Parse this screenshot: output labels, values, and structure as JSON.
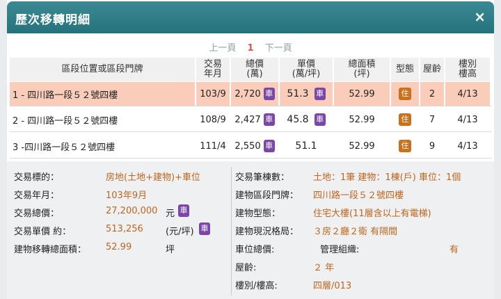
{
  "dialog": {
    "title": "歷次移轉明細",
    "close_label": "×"
  },
  "pager": {
    "prev": "上一頁",
    "current": "1",
    "next": "下一頁"
  },
  "table": {
    "headers": [
      {
        "l1": "區段位置或區段門牌",
        "l2": ""
      },
      {
        "l1": "交易",
        "l2": "年月"
      },
      {
        "l1": "總價",
        "l2": "(萬)"
      },
      {
        "l1": "單價",
        "l2": "(萬/坪)"
      },
      {
        "l1": "總面積",
        "l2": "(坪)"
      },
      {
        "l1": "型態",
        "l2": ""
      },
      {
        "l1": "屋齡",
        "l2": ""
      },
      {
        "l1": "樓別",
        "l2": "樓高"
      }
    ],
    "rows": [
      {
        "address": "1 - 四川路一段５２號四樓",
        "date": "103/9",
        "total": "2,720",
        "unit": "51.3",
        "area": "52.99",
        "type_icon": "住",
        "age": "2",
        "floor": "4/13",
        "total_badge": "車",
        "unit_badge": "車"
      },
      {
        "address": "2 - 四川路一段５２號四樓",
        "date": "108/9",
        "total": "2,427",
        "unit": "45.8",
        "area": "52.99",
        "type_icon": "住",
        "age": "7",
        "floor": "4/13",
        "total_badge": "車",
        "unit_badge": "車"
      },
      {
        "address": "3 -四川路一段５２號四樓",
        "date": "111/4",
        "total": "2,550",
        "unit": "51.1",
        "area": "52.99",
        "type_icon": "住",
        "age": "9",
        "floor": "4/13",
        "total_badge": "車",
        "unit_badge": ""
      }
    ]
  },
  "details": {
    "left": [
      {
        "label": "交易標的：",
        "value": "房地(土地+建物)+車位",
        "unit": "",
        "badge": ""
      },
      {
        "label": "交易年月：",
        "value": "103年9月",
        "unit": "",
        "badge": ""
      },
      {
        "label": "交易總價：",
        "value": "27,200,000",
        "unit": "元",
        "badge": "車"
      },
      {
        "label": "交易單價 約：",
        "value": "513,256",
        "unit": "(元/坪)",
        "badge": "車"
      },
      {
        "label": "建物移轉總面積：",
        "value": "52.99",
        "unit": "坪",
        "badge": ""
      }
    ],
    "right": [
      {
        "label": "交易筆棟數：",
        "value": "土地：1筆 建物：1棟(戶) 車位：1個"
      },
      {
        "label": "建物區段門牌：",
        "value": "四川路一段５２號四樓"
      },
      {
        "label": "建物型態：",
        "value": "住宅大樓(11層含以上有電梯)"
      },
      {
        "label": "建物現況格局：",
        "value": "３房２廳２衛 有隔間"
      },
      {
        "label": "車位總價:",
        "value": ""
      },
      {
        "label": "屋齡:",
        "value": "２ 年"
      },
      {
        "label": "樓別/樓高:",
        "value": "四層/013"
      }
    ],
    "management_label": "管理組織:",
    "management_value": "有"
  }
}
